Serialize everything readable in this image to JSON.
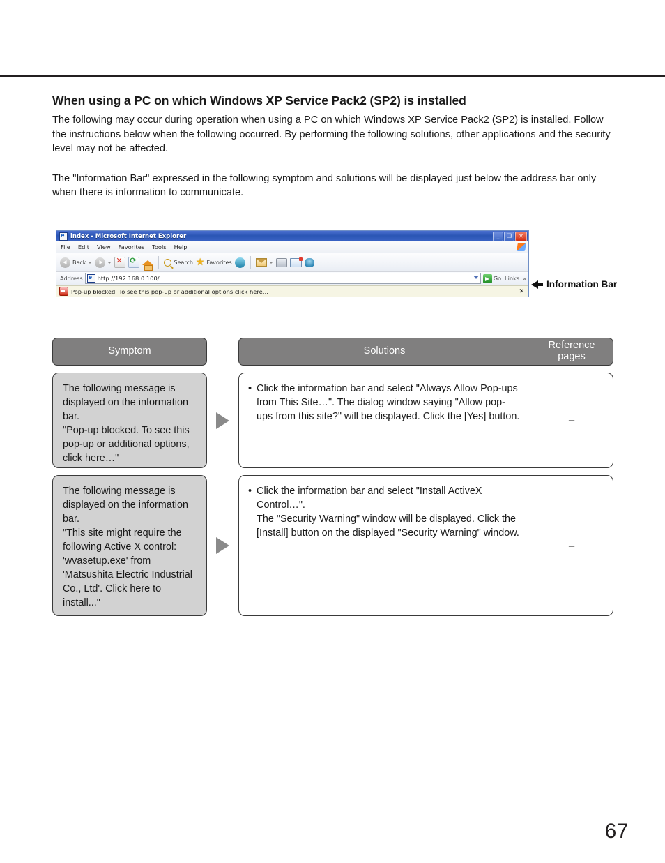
{
  "page": {
    "number": "67"
  },
  "section": {
    "title": "When using a PC on which Windows XP Service Pack2 (SP2) is installed",
    "paragraph1": "The following may occur during operation when using a PC on which Windows XP Service Pack2 (SP2) is installed. Follow the instructions below when the following occurred. By performing the following solutions, other applications and the security level may not be affected.",
    "paragraph2": "The \"Information Bar\" expressed in the following symptom and solutions will be displayed just below the address bar only when there is information to communicate."
  },
  "browser": {
    "title": "index - Microsoft Internet Explorer",
    "window_buttons": {
      "minimize": "_",
      "restore": "❐",
      "close": "✕"
    },
    "menu": [
      "File",
      "Edit",
      "View",
      "Favorites",
      "Tools",
      "Help"
    ],
    "toolbar": {
      "back": "Back",
      "search": "Search",
      "favorites": "Favorites"
    },
    "address": {
      "label": "Address",
      "url": "http://192.168.0.100/",
      "go": "Go",
      "links": "Links",
      "overflow": "»"
    },
    "information_bar": {
      "message": "Pop-up blocked. To see this pop-up or additional options click here…",
      "close": "✕"
    }
  },
  "callout": {
    "label": "Information Bar"
  },
  "table": {
    "headers": {
      "symptom": "Symptom",
      "solutions": "Solutions",
      "reference": "Reference\npages"
    },
    "rows": [
      {
        "symptom": "The following message is displayed on the information bar.\n\"Pop-up blocked. To see this pop-up or additional options, click here…\"",
        "bullet": "•",
        "solution": "Click the information bar and select \"Always Allow Pop-ups from This Site…\". The dialog window saying \"Allow pop-ups from this site?\" will be displayed. Click the [Yes] button.",
        "reference": "–"
      },
      {
        "symptom": "The following message is displayed on the information bar.\n\"This site might require the following Active X control: 'wvasetup.exe' from 'Matsushita Electric Industrial Co., Ltd'. Click here to install...\"",
        "bullet": "•",
        "solution": "Click the information bar and select \"Install ActiveX Control…\".\nThe \"Security Warning\" window will be displayed. Click the [Install] button on the displayed \"Security Warning\" window.",
        "reference": "–"
      }
    ]
  },
  "colors": {
    "header_gray": "#807f7f",
    "symptom_gray": "#d2d2d2",
    "border_dark": "#3a3a3a",
    "arrow_gray": "#8a8a8a",
    "rule_black": "#231f20",
    "infobar_cream": "#f6f5e4"
  }
}
